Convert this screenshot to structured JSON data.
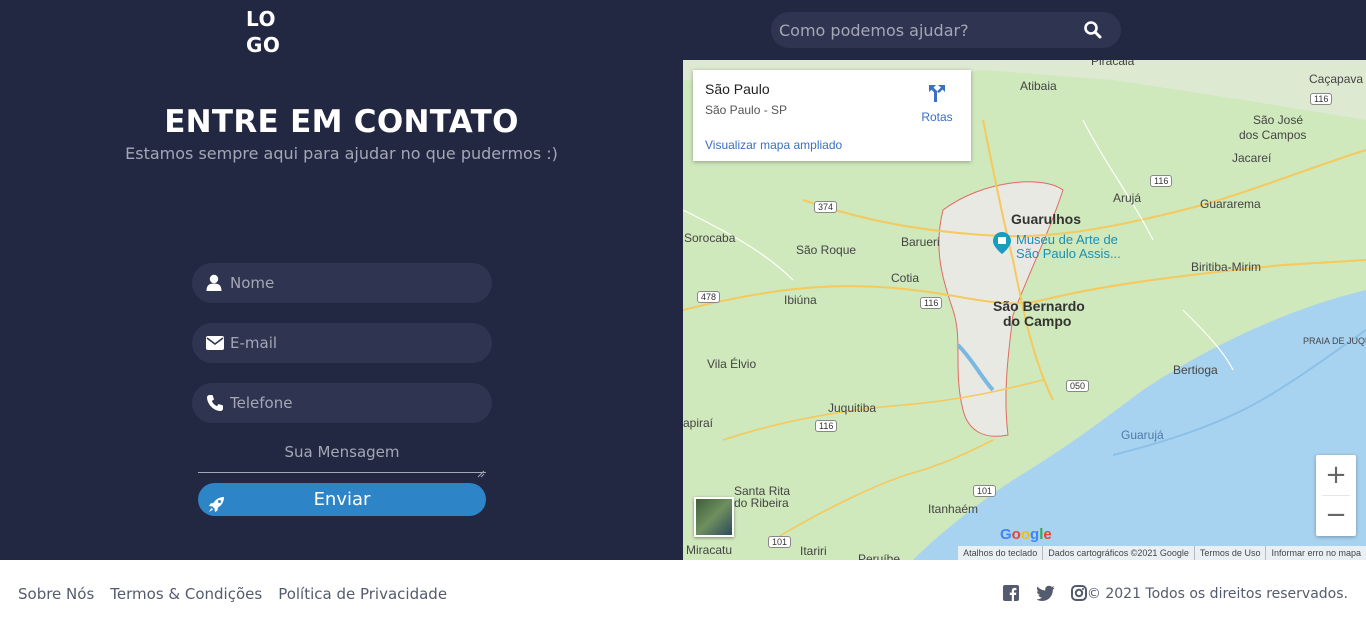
{
  "header": {
    "logo": [
      "LO",
      "GO"
    ],
    "search_placeholder": "Como podemos ajudar?"
  },
  "contact": {
    "title": "ENTRE EM CONTATO",
    "subtitle": "Estamos sempre aqui para ajudar no que pudermos :)",
    "name_placeholder": "Nome",
    "email_placeholder": "E-mail",
    "phone_placeholder": "Telefone",
    "message_placeholder": "Sua Mensagem",
    "send_label": "Enviar"
  },
  "map": {
    "place_name": "São Paulo",
    "place_address": "São Paulo - SP",
    "enlarge_link": "Visualizar mapa ampliado",
    "directions_label": "Rotas",
    "labels": {
      "piracaia": "Piracaia",
      "cacapava": "Caçapava",
      "atibaia": "Atibaia",
      "sjc": "São José",
      "sjc2": "dos Campos",
      "jacarei": "Jacareí",
      "aruja": "Arujá",
      "guararema": "Guararema",
      "guarulhos": "Guarulhos",
      "sorocaba": "Sorocaba",
      "barueri": "Barueri",
      "sao_roque": "São Roque",
      "cotia": "Cotia",
      "museu1": "Museu de Arte de",
      "museu2": "São Paulo Assis...",
      "biritiba": "Biritiba-Mirim",
      "ibiuna": "Ibiúna",
      "sbc1": "São Bernardo",
      "sbc2": "do Campo",
      "praia": "PRAIA DE JUQU",
      "vila_elvio": "Vila Élvio",
      "bertioga": "Bertioga",
      "juquitiba": "Juquitiba",
      "apirai": "apiraí",
      "guaruja": "Guarujá",
      "santa_rita1": "Santa Rita",
      "santa_rita2": "do Ribeira",
      "itanhaem": "Itanhaém",
      "miracatu": "Miracatu",
      "itariri": "Itariri",
      "peruibe": "Peruíbe"
    },
    "shields": {
      "s116a": "116",
      "s116b": "116",
      "s116c": "116",
      "s116d": "116",
      "s374": "374",
      "s478": "478",
      "s050": "050",
      "s101a": "101",
      "s101b": "101"
    },
    "zoom_in": "+",
    "zoom_out": "−",
    "google": "Google",
    "attribution": [
      "Atalhos do teclado",
      "Dados cartográficos ©2021 Google",
      "Termos de Uso",
      "Informar erro no mapa"
    ]
  },
  "footer": {
    "links": [
      "Sobre Nós",
      "Termos & Condições",
      "Política de Privacidade"
    ],
    "copyright": "© 2021 Todos os direitos reservados."
  },
  "colors": {
    "header_bg": "#232842",
    "field_bg": "#2f3551",
    "accent": "#2d84c6",
    "footer_text": "#555b6e"
  }
}
